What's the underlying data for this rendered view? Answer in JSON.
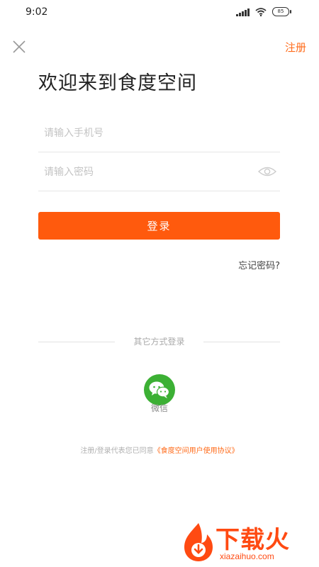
{
  "status_bar": {
    "time": "9:02",
    "battery": "85"
  },
  "header": {
    "register_label": "注册"
  },
  "page_title": "欢迎来到食度空间",
  "form": {
    "phone_placeholder": "请输入手机号",
    "phone_value": "",
    "password_placeholder": "请输入密码",
    "password_value": "",
    "login_label": "登录",
    "forgot_label": "忘记密码?"
  },
  "other_login": {
    "divider_text": "其它方式登录",
    "wechat_label": "微信"
  },
  "agreement": {
    "prefix": "注册/登录代表您已同意",
    "link": "《食度空间用户使用协议》"
  },
  "watermark": {
    "title": "下载火",
    "url": "xiazaihuo.com"
  },
  "colors": {
    "accent": "#ff5a0d",
    "wechat": "#3cb034"
  }
}
